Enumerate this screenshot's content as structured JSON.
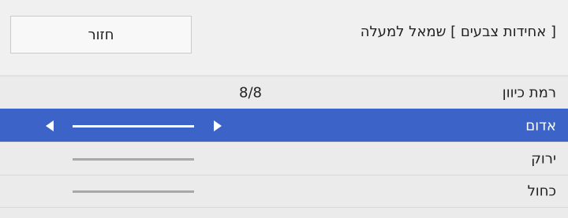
{
  "header": {
    "back_label": "חזור",
    "title": "[ אחידות צבעים ] שמאל למעלה"
  },
  "rows": [
    {
      "label": "רמת כיוון",
      "value": "8/8"
    },
    {
      "label": "אדום",
      "selected": true
    },
    {
      "label": "ירוק"
    },
    {
      "label": "כחול"
    }
  ],
  "colors": {
    "selected_row": "#3c64c8",
    "background": "#ebebeb",
    "slider_inactive": "#a8a8a8",
    "slider_active": "#ffffff"
  }
}
